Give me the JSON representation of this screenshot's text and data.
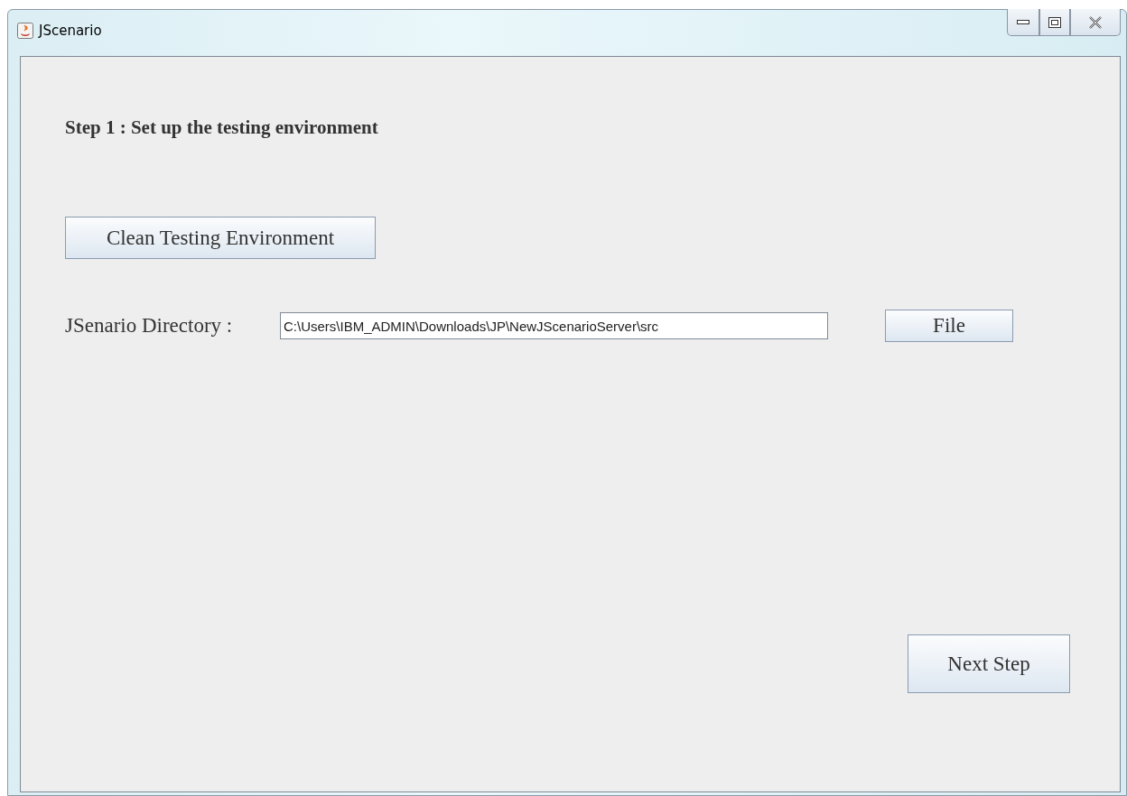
{
  "window": {
    "title": "JScenario"
  },
  "step_heading": "Step 1 : Set up the testing environment",
  "clean_button": "Clean Testing Environment",
  "directory": {
    "label": "JSenario Directory :",
    "value": "C:\\Users\\IBM_ADMIN\\Downloads\\JP\\NewJScenarioServer\\src",
    "file_button": "File"
  },
  "next_button": "Next Step"
}
